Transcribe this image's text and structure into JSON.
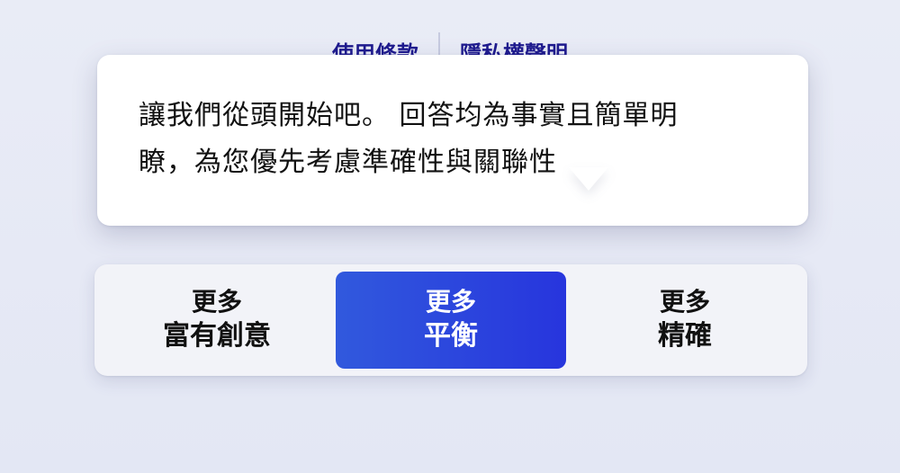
{
  "footer_links": {
    "terms": "使用條款",
    "privacy": "隱私權聲明"
  },
  "tooltip": {
    "line1": "讓我們從頭開始吧。 回答均為事實且簡單明",
    "line2": "瞭，為您優先考慮準確性與關聯性"
  },
  "tone_selector": {
    "selected": "balanced",
    "options": [
      {
        "id": "creative",
        "line1": "更多",
        "line2": "富有創意"
      },
      {
        "id": "balanced",
        "line1": "更多",
        "line2": "平衡"
      },
      {
        "id": "precise",
        "line1": "更多",
        "line2": "精確"
      }
    ]
  },
  "colors": {
    "accent_start": "#3159dd",
    "accent_end": "#2735dd",
    "link": "#1e1a8e"
  }
}
